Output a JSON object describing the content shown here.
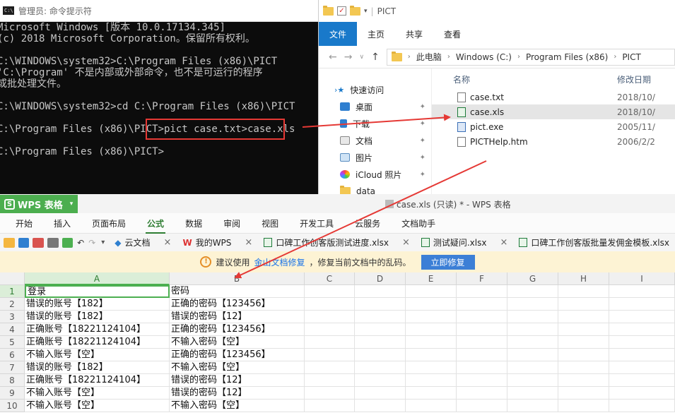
{
  "cmd": {
    "title": "管理员: 命令提示符",
    "lines": [
      "Microsoft Windows [版本 10.0.17134.345]",
      "(c) 2018 Microsoft Corporation。保留所有权利。",
      "",
      "C:\\WINDOWS\\system32>C:\\Program Files (x86)\\PICT",
      "'C:\\Program' 不是内部或外部命令，也不是可运行的程序",
      "或批处理文件。",
      "",
      "C:\\WINDOWS\\system32>cd C:\\Program Files (x86)\\PICT",
      "",
      "C:\\Program Files (x86)\\PICT>pict case.txt>case.xls",
      "",
      "C:\\Program Files (x86)\\PICT>"
    ]
  },
  "explorer": {
    "title": "PICT",
    "ribbon": [
      "文件",
      "主页",
      "共享",
      "查看"
    ],
    "breadcrumb": [
      "此电脑",
      "Windows (C:)",
      "Program Files (x86)",
      "PICT"
    ],
    "nav": {
      "quick": "快速访问",
      "items": [
        "桌面",
        "下载",
        "文档",
        "图片",
        "iCloud 照片",
        "data"
      ]
    },
    "columns": {
      "name": "名称",
      "date": "修改日期"
    },
    "files": [
      {
        "name": "case.txt",
        "date": "2018/10/",
        "icon": "txt-file-icon"
      },
      {
        "name": "case.xls",
        "date": "2018/10/",
        "icon": "xls-file-icon"
      },
      {
        "name": "pict.exe",
        "date": "2005/11/",
        "icon": "exe-file-icon"
      },
      {
        "name": "PICTHelp.htm",
        "date": "2006/2/2",
        "icon": "htm-file-icon"
      }
    ]
  },
  "wps": {
    "app_label": "WPS 表格",
    "window_title": "case.xls (只读) * - WPS 表格",
    "menu": [
      "开始",
      "插入",
      "页面布局",
      "公式",
      "数据",
      "审阅",
      "视图",
      "开发工具",
      "云服务",
      "文档助手"
    ],
    "doc_tabs": [
      "云文档",
      "我的WPS",
      "口碑工作创客版测试进度.xlsx",
      "测试疑问.xlsx",
      "口碑工作创客版批量发佣金模板.xlsx"
    ],
    "notice": {
      "pre": "建议使用",
      "link": "金山文档修复",
      "post": "，修复当前文档中的乱码。",
      "button": "立即修复"
    },
    "columns": [
      "A",
      "B",
      "C",
      "D",
      "E",
      "F",
      "G",
      "H",
      "I"
    ],
    "rows": [
      [
        "登录",
        "密码"
      ],
      [
        "错误的账号【182】",
        "正确的密码【123456】"
      ],
      [
        "错误的账号【182】",
        "错误的密码【12】"
      ],
      [
        "正确账号【18221124104】",
        "正确的密码【123456】"
      ],
      [
        "正确账号【18221124104】",
        "不输入密码【空】"
      ],
      [
        "不输入账号【空】",
        "正确的密码【123456】"
      ],
      [
        "错误的账号【182】",
        "不输入密码【空】"
      ],
      [
        "正确账号【18221124104】",
        "错误的密码【12】"
      ],
      [
        "不输入账号【空】",
        "错误的密码【12】"
      ],
      [
        "不输入账号【空】",
        "不输入密码【空】"
      ]
    ]
  },
  "colors": {
    "arrow": "#e53935",
    "wps_green": "#4cae4f",
    "explorer_file_tab": "#1979ca"
  }
}
